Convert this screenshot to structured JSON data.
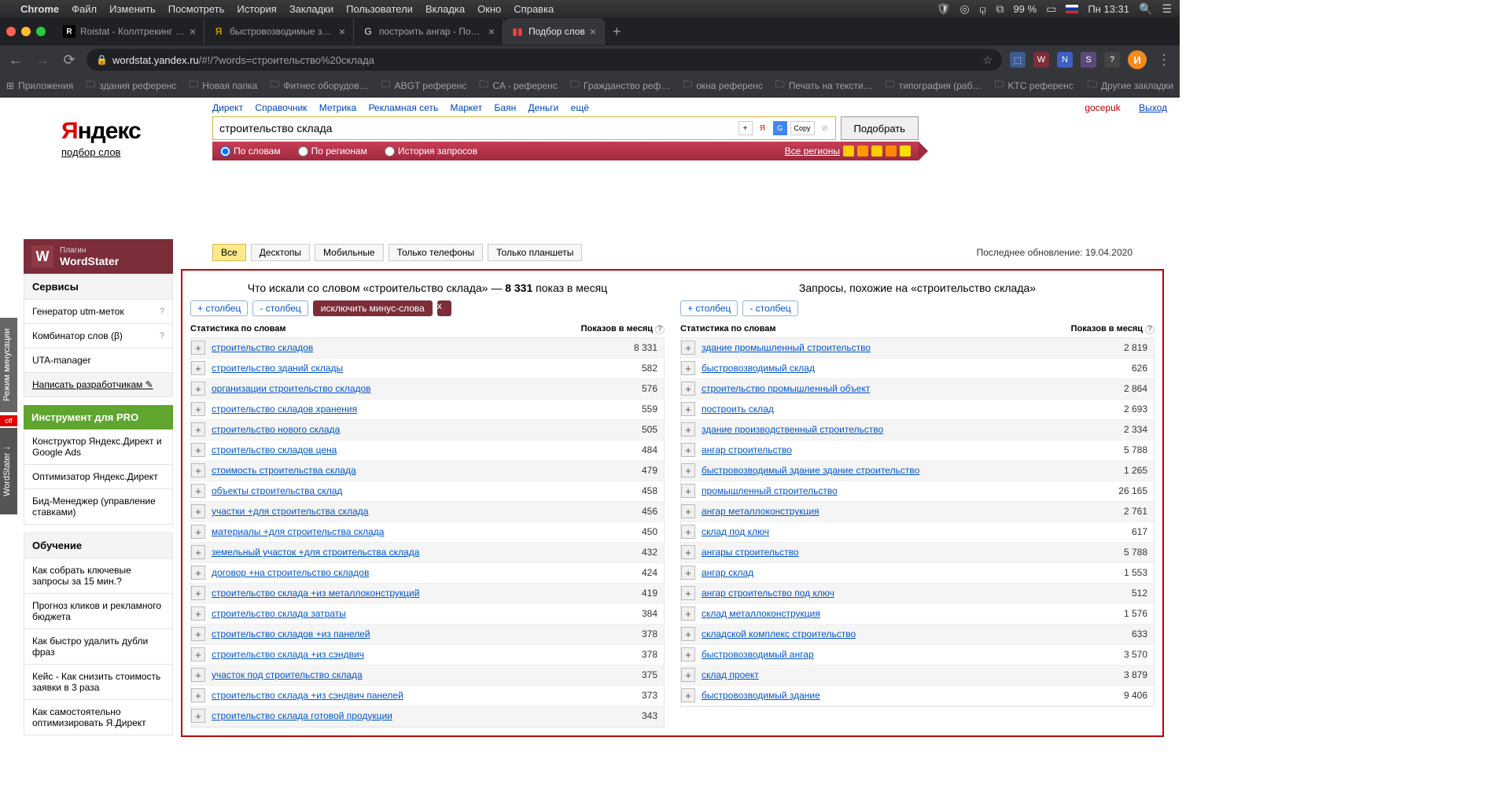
{
  "macos": {
    "app": "Chrome",
    "menu": [
      "Файл",
      "Изменить",
      "Посмотреть",
      "История",
      "Закладки",
      "Пользователи",
      "Вкладка",
      "Окно",
      "Справка"
    ],
    "battery": "99 %",
    "time": "Пн 13:31"
  },
  "browser": {
    "tabs": [
      {
        "title": "Roistat - Коллтрекинг - Исто",
        "fav": "R"
      },
      {
        "title": "быстровозводимые здания —",
        "fav": "Я"
      },
      {
        "title": "построить ангар - Поиск в G",
        "fav": "G"
      },
      {
        "title": "Подбор слов",
        "fav": "📊",
        "active": true
      }
    ],
    "url_host": "wordstat.yandex.ru",
    "url_path": "/#!/?words=строительство%20склада",
    "bookmarks_label": "Приложения",
    "bookmarks": [
      "здания референс",
      "Новая папка",
      "Фитнес оборудов…",
      "ABGT референс",
      "CA - референс",
      "Гражданство реф…",
      "окна референс",
      "Печать на тексти…",
      "типография (раб…",
      "KTC референс"
    ],
    "bookmarks_other": "Другие закладки"
  },
  "page": {
    "top_links": [
      "Директ",
      "Справочник",
      "Метрика",
      "Рекламная сеть",
      "Маркет",
      "Баян",
      "Деньги",
      "ещё"
    ],
    "username": "gocepuk",
    "logout": "Выход",
    "logo_sub": "подбор слов",
    "search_value": "строительство склада",
    "submit": "Подобрать",
    "copy": "Copy",
    "modes": {
      "words": "По словам",
      "regions": "По регионам",
      "history": "История запросов"
    },
    "all_regions": "Все регионы"
  },
  "ws": {
    "plugin": "Плагин",
    "name": "WordStater",
    "services": "Сервисы",
    "svc": [
      "Генератор utm-меток",
      "Комбинатор слов (β)",
      "UTA-manager"
    ],
    "write_dev": "Написать разработчикам",
    "pro": "Инструмент для PRO",
    "pro_items": [
      "Конструктор Яндекс.Директ и Google Ads",
      "Оптимизатор Яндекс.Директ",
      "Бид-Менеджер (управление ставками)"
    ],
    "edu": "Обучение",
    "edu_items": [
      "Как собрать ключевые запросы за 15 мин.?",
      "Прогноз кликов и рекламного бюджета",
      "Как быстро удалить дубли фраз",
      "Кейс - Как снизить стоимость заявки в 3 раза",
      "Как самостоятельно оптимизировать Я.Директ"
    ]
  },
  "vtabs": {
    "off": "off",
    "v1": "Режим минусации",
    "v2": "WordStater ↓"
  },
  "filters": {
    "all": "Все",
    "desktop": "Десктопы",
    "mobile": "Мобильные",
    "phones": "Только телефоны",
    "tablets": "Только планшеты",
    "updated": "Последнее обновление: 19.04.2020"
  },
  "controls": {
    "add_col": "+ столбец",
    "rem_col": "- столбец",
    "exclude_minus": "исключить минус-слова",
    "stat_words": "Статистика по словам",
    "shows": "Показов в месяц"
  },
  "left": {
    "title_prefix": "Что искали со словом «строительство склада» — ",
    "title_count": "8 331",
    "title_suffix": " показ в месяц",
    "rows": [
      {
        "kw": "строительство складов",
        "cnt": "8 331"
      },
      {
        "kw": "строительство зданий склады",
        "cnt": "582"
      },
      {
        "kw": "организации строительство складов",
        "cnt": "576"
      },
      {
        "kw": "строительство складов хранения",
        "cnt": "559"
      },
      {
        "kw": "строительство нового склада",
        "cnt": "505"
      },
      {
        "kw": "строительство складов цена",
        "cnt": "484"
      },
      {
        "kw": "стоимость строительства склада",
        "cnt": "479"
      },
      {
        "kw": "объекты строительства склад",
        "cnt": "458"
      },
      {
        "kw": "участки +для строительства склада",
        "cnt": "456"
      },
      {
        "kw": "материалы +для строительства склада",
        "cnt": "450"
      },
      {
        "kw": "земельный участок +для строительства склада",
        "cnt": "432"
      },
      {
        "kw": "договор +на строительство складов",
        "cnt": "424"
      },
      {
        "kw": "строительство склада +из металлоконструкций",
        "cnt": "419"
      },
      {
        "kw": "строительство склада затраты",
        "cnt": "384"
      },
      {
        "kw": "строительство складов +из панелей",
        "cnt": "378"
      },
      {
        "kw": "строительство склада +из сэндвич",
        "cnt": "378"
      },
      {
        "kw": "участок под строительство склада",
        "cnt": "375"
      },
      {
        "kw": "строительство склада +из сэндвич панелей",
        "cnt": "373"
      },
      {
        "kw": "строительство склада готовой продукции",
        "cnt": "343"
      }
    ]
  },
  "right": {
    "title": "Запросы, похожие на «строительство склада»",
    "rows": [
      {
        "kw": "здание промышленный строительство",
        "cnt": "2 819"
      },
      {
        "kw": "быстровозводимый склад",
        "cnt": "626"
      },
      {
        "kw": "строительство промышленный объект",
        "cnt": "2 864"
      },
      {
        "kw": "построить склад",
        "cnt": "2 693"
      },
      {
        "kw": "здание производственный строительство",
        "cnt": "2 334"
      },
      {
        "kw": "ангар строительство",
        "cnt": "5 788"
      },
      {
        "kw": "быстровозводимый здание здание строительство",
        "cnt": "1 265"
      },
      {
        "kw": "промышленный строительство",
        "cnt": "26 165"
      },
      {
        "kw": "ангар металлоконструкция",
        "cnt": "2 761"
      },
      {
        "kw": "склад под ключ",
        "cnt": "617"
      },
      {
        "kw": "ангары строительство",
        "cnt": "5 788"
      },
      {
        "kw": "ангар склад",
        "cnt": "1 553"
      },
      {
        "kw": "ангар строительство под ключ",
        "cnt": "512"
      },
      {
        "kw": "склад металлоконструкция",
        "cnt": "1 576"
      },
      {
        "kw": "складской комплекс строительство",
        "cnt": "633"
      },
      {
        "kw": "быстровозводимый ангар",
        "cnt": "3 570"
      },
      {
        "kw": "склад проект",
        "cnt": "3 879"
      },
      {
        "kw": "быстровозводимый здание",
        "cnt": "9 406"
      }
    ]
  }
}
